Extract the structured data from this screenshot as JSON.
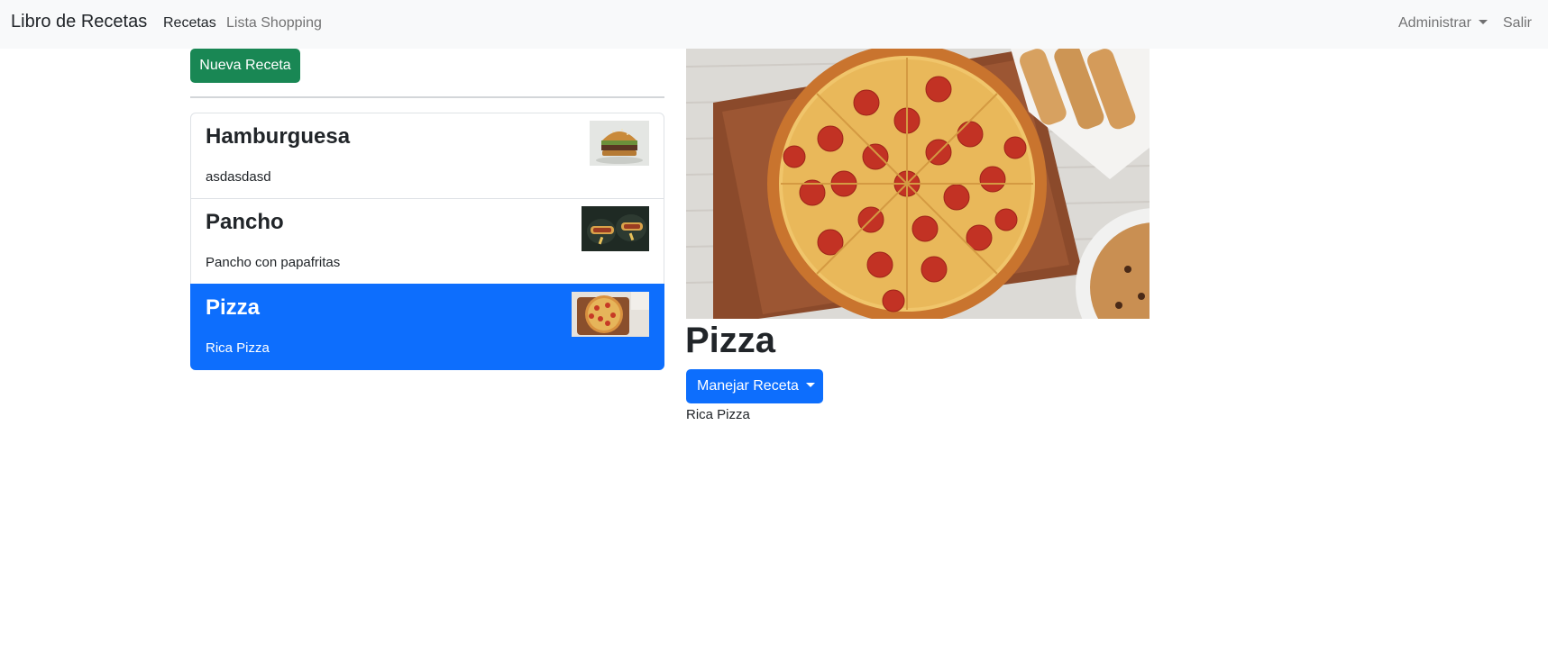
{
  "navbar": {
    "brand": "Libro de Recetas",
    "links": [
      "Recetas",
      "Lista Shopping"
    ],
    "admin": "Administrar",
    "logout": "Salir"
  },
  "list": {
    "new_button": "Nueva Receta",
    "recipes": [
      {
        "name": "Hamburguesa",
        "description": "asdasdasd",
        "active": false
      },
      {
        "name": "Pancho",
        "description": "Pancho con papafritas",
        "active": false
      },
      {
        "name": "Pizza",
        "description": "Rica Pizza",
        "active": true
      }
    ]
  },
  "detail": {
    "title": "Pizza",
    "manage_button": "Manejar Receta",
    "description": "Rica Pizza"
  },
  "colors": {
    "navbar_bg": "#f8f9fa",
    "success": "#198754",
    "primary": "#0d6efd"
  }
}
